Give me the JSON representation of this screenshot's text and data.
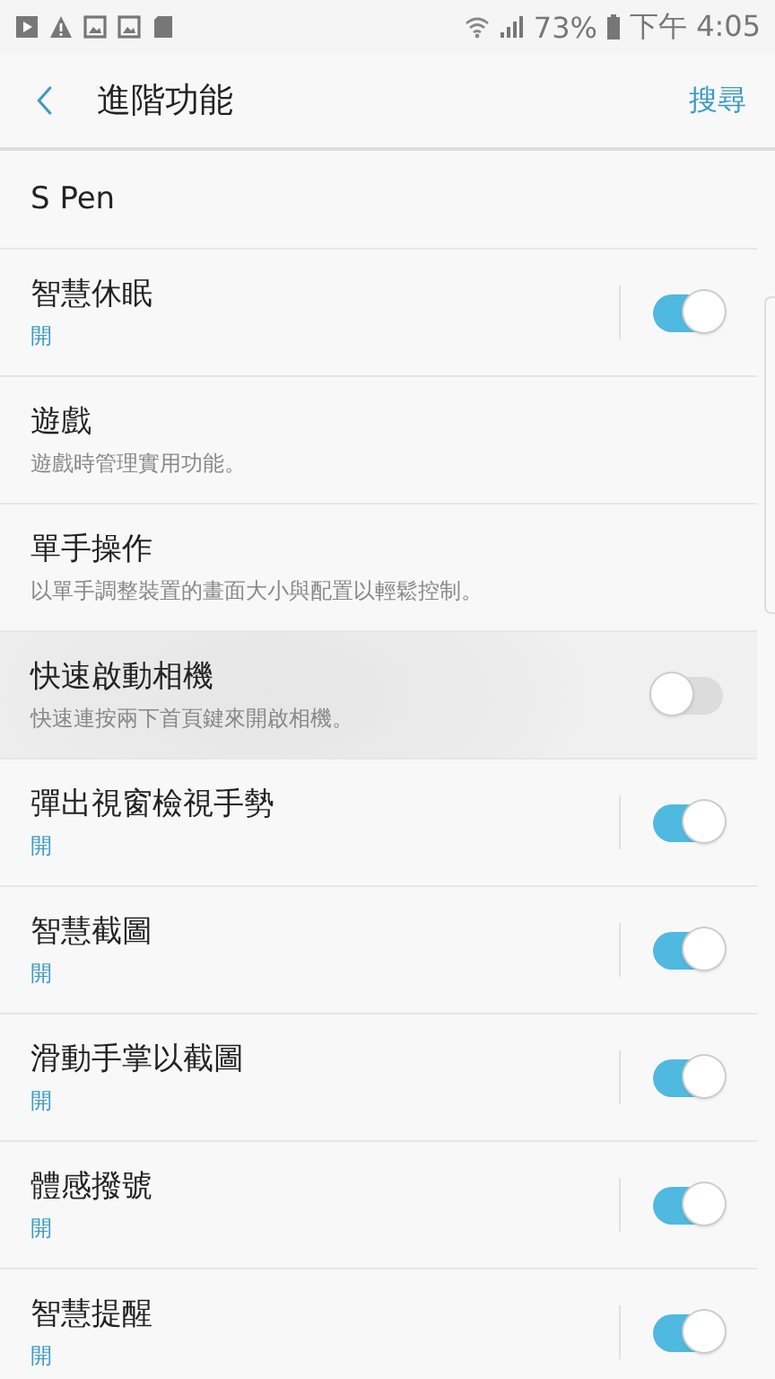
{
  "status_bar": {
    "battery": "73%",
    "time": "下午 4:05"
  },
  "header": {
    "title": "進階功能",
    "action": "搜尋"
  },
  "items": [
    {
      "kind": "link",
      "title": "S Pen"
    },
    {
      "kind": "toggle",
      "title": "智慧休眠",
      "status": "開",
      "on": true
    },
    {
      "kind": "link",
      "title": "遊戲",
      "description": "遊戲時管理實用功能。"
    },
    {
      "kind": "link",
      "title": "單手操作",
      "description": "以單手調整裝置的畫面大小與配置以輕鬆控制。"
    },
    {
      "kind": "toggle",
      "title": "快速啟動相機",
      "description": "快速連按兩下首頁鍵來開啟相機。",
      "on": false,
      "pressed": true
    },
    {
      "kind": "toggle",
      "title": "彈出視窗檢視手勢",
      "status": "開",
      "on": true
    },
    {
      "kind": "toggle",
      "title": "智慧截圖",
      "status": "開",
      "on": true
    },
    {
      "kind": "toggle",
      "title": "滑動手掌以截圖",
      "status": "開",
      "on": true
    },
    {
      "kind": "toggle",
      "title": "體感撥號",
      "status": "開",
      "on": true
    },
    {
      "kind": "toggle",
      "title": "智慧提醒",
      "status": "開",
      "on": true
    }
  ]
}
